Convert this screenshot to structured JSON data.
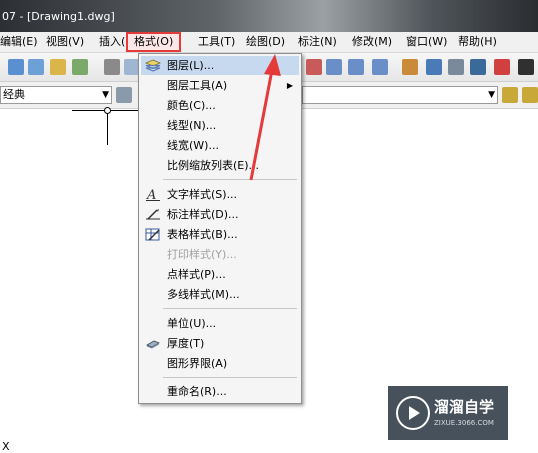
{
  "window": {
    "title": "07 - [Drawing1.dwg]"
  },
  "menubar": {
    "items": [
      {
        "label": "编辑(E)"
      },
      {
        "label": "视图(V)"
      },
      {
        "label": "插入(I)"
      },
      {
        "label": "格式(O)"
      },
      {
        "label": "工具(T)"
      },
      {
        "label": "绘图(D)"
      },
      {
        "label": "标注(N)"
      },
      {
        "label": "修改(M)"
      },
      {
        "label": "窗口(W)"
      },
      {
        "label": "帮助(H)"
      }
    ],
    "active_index": 3
  },
  "toolbar": {
    "style_combo_value": "经典"
  },
  "format_menu": {
    "items": [
      {
        "label": "图层(L)...",
        "icon": "layers-icon",
        "highlighted": true
      },
      {
        "label": "图层工具(A)",
        "submenu": true
      },
      {
        "label": "颜色(C)..."
      },
      {
        "label": "线型(N)..."
      },
      {
        "label": "线宽(W)..."
      },
      {
        "label": "比例缩放列表(E)..."
      },
      {
        "label": "文字样式(S)...",
        "icon": "text-style-icon"
      },
      {
        "label": "标注样式(D)...",
        "icon": "dimension-style-icon"
      },
      {
        "label": "表格样式(B)...",
        "icon": "table-style-icon"
      },
      {
        "label": "打印样式(Y)...",
        "disabled": true
      },
      {
        "label": "点样式(P)..."
      },
      {
        "label": "多线样式(M)..."
      },
      {
        "label": "单位(U)..."
      },
      {
        "label": "厚度(T)",
        "icon": "thickness-icon"
      },
      {
        "label": "图形界限(A)"
      },
      {
        "label": "重命名(R)..."
      }
    ]
  },
  "watermark": {
    "title": "溜溜自学",
    "subtitle": "ZIXUE.3066.COM"
  },
  "command_line": {
    "text": "X"
  },
  "colors": {
    "highlight_outline": "#e53a3a",
    "arrow": "#e53a3a",
    "menu_highlight": "#c7d9ee"
  }
}
